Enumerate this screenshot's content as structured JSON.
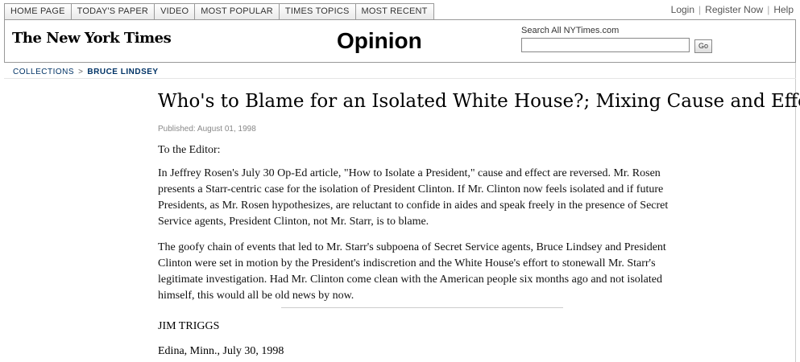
{
  "nav": {
    "tabs": [
      "HOME PAGE",
      "TODAY'S PAPER",
      "VIDEO",
      "MOST POPULAR",
      "TIMES TOPICS",
      "MOST RECENT"
    ]
  },
  "user": {
    "login": "Login",
    "register": "Register Now",
    "help": "Help",
    "separator": "|"
  },
  "masthead": {
    "logo": "The New York Times",
    "section": "Opinion",
    "search_label": "Search All NYTimes.com",
    "search_value": "",
    "go_label": "Go"
  },
  "breadcrumb": {
    "collections": "COLLECTIONS",
    "separator": ">",
    "current": "BRUCE LINDSEY"
  },
  "article": {
    "headline": "Who's to Blame for an Isolated White House?; Mixing Cause and Effect",
    "published": "Published: August 01, 1998",
    "salutation": "To the Editor:",
    "paragraph1": "In Jeffrey Rosen's July 30 Op-Ed article, \"How to Isolate a President,\" cause and effect are reversed. Mr. Rosen presents a Starr-centric case for the isolation of President Clinton. If Mr. Clinton now feels isolated and if future Presidents, as Mr. Rosen hypothesizes, are reluctant to confide in aides and speak freely in the presence of Secret Service agents, President Clinton, not Mr. Starr, is to blame.",
    "paragraph2": "The goofy chain of events that led to Mr. Starr's subpoena of Secret Service agents, Bruce Lindsey and President Clinton were set in motion by the President's indiscretion and the White House's effort to stonewall Mr. Starr's legitimate investigation. Had Mr. Clinton come clean with the American people six months ago and not isolated himself, this would all be old news by now.",
    "signature": "JIM TRIGGS",
    "location": "Edina, Minn., July 30, 1998"
  }
}
